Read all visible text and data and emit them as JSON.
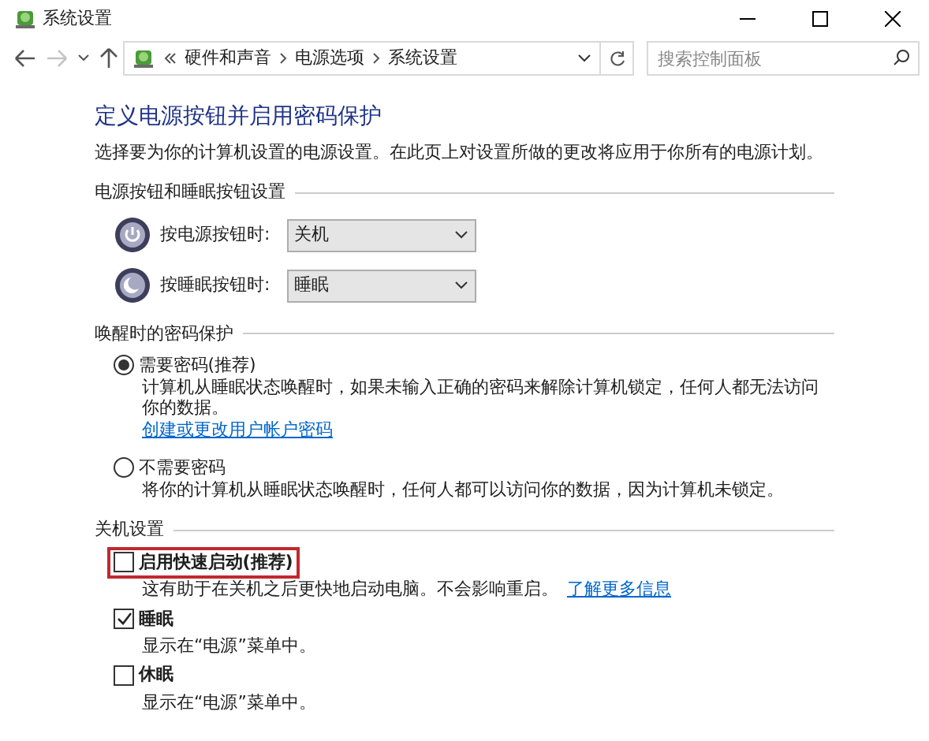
{
  "window": {
    "title": "系统设置"
  },
  "address_bar": {
    "breadcrumbs": [
      "硬件和声音",
      "电源选项",
      "系统设置"
    ]
  },
  "search": {
    "placeholder": "搜索控制面板"
  },
  "heading": "定义电源按钮并启用密码保护",
  "description": "选择要为你的计算机设置的电源设置。在此页上对设置所做的更改将应用于你所有的电源计划。",
  "button_settings": {
    "title": "电源按钮和睡眠按钮设置",
    "rows": [
      {
        "kind": "power",
        "label": "按电源按钮时:",
        "value": "关机"
      },
      {
        "kind": "sleep",
        "label": "按睡眠按钮时:",
        "value": "睡眠"
      }
    ]
  },
  "password_protection": {
    "title": "唤醒时的密码保护",
    "options": [
      {
        "label": "需要密码(推荐)",
        "selected": true,
        "description": "计算机从睡眠状态唤醒时，如果未输入正确的密码来解除计算机锁定，任何人都无法访问你的数据。",
        "link": "创建或更改用户帐户密码"
      },
      {
        "label": "不需要密码",
        "selected": false,
        "description": "将你的计算机从睡眠状态唤醒时，任何人都可以访问你的数据，因为计算机未锁定。"
      }
    ]
  },
  "shutdown_settings": {
    "title": "关机设置",
    "items": [
      {
        "label": "启用快速启动(推荐)",
        "checked": false,
        "highlighted": true,
        "description": "这有助于在关机之后更快地启动电脑。不会影响重启。",
        "link": "了解更多信息"
      },
      {
        "label": "睡眠",
        "checked": true,
        "highlighted": false,
        "description": "显示在“电源”菜单中。"
      },
      {
        "label": "休眠",
        "checked": false,
        "highlighted": false,
        "description": "显示在“电源”菜单中。"
      }
    ]
  }
}
